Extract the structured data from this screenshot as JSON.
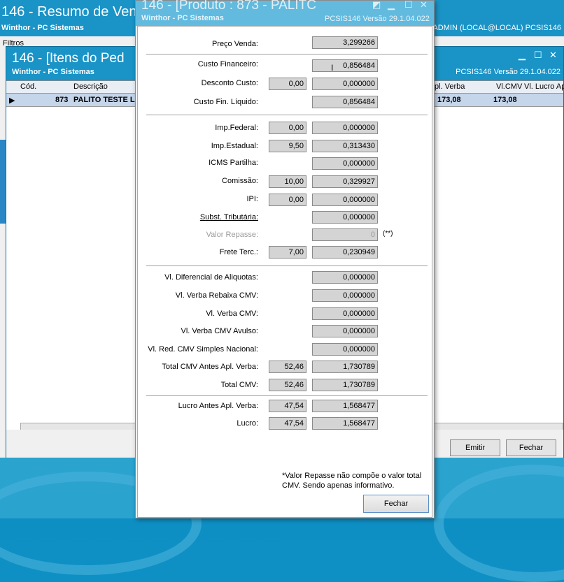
{
  "bg_window1": {
    "title": "146 - Resumo de Ven",
    "subtitle": "Winthor - PC Sistemas",
    "right_info": "ADMIN (LOCAL@LOCAL)   PCSIS146",
    "filtros": "Filtros"
  },
  "bg_window2": {
    "title": "146 - [Itens do Ped",
    "subtitle": "Winthor - PC Sistemas",
    "right_info": "PCSIS146  Versão  29.1.04.022",
    "columns": [
      "Cód.",
      "Descrição",
      "pl. Verba",
      "Vl.CMV",
      "Vl. Lucro Ap"
    ],
    "row": {
      "cod": "873",
      "descricao": "PALITO TESTE LA",
      "apl_verba": "173,08",
      "vl_cmv": "173,08"
    },
    "emitir_label": "Emitir",
    "fechar_label": "Fechar"
  },
  "dialog": {
    "title": "146 - [Produto : 873 - PALITC",
    "subtitle": "Winthor - PC Sistemas",
    "right_info": "PCSIS146  Versão  29.1.04.022",
    "labels": {
      "preco_venda": "Preço Venda:",
      "custo_financeiro": "Custo Financeiro:",
      "desconto_custo": "Desconto Custo:",
      "custo_fin_liquido": "Custo Fin. Líquido:",
      "imp_federal": "Imp.Federal:",
      "imp_estadual": "Imp.Estadual:",
      "icms_partilha": "ICMS Partilha:",
      "comissao": "Comissão:",
      "ipi": "IPI:",
      "subst_tributaria": "Subst. Tributária:",
      "valor_repasse": "Valor Repasse:",
      "frete_terc": "Frete Terc.:",
      "vl_dif_aliquotas": "Vl. Diferencial de Aliquotas:",
      "vl_verba_rebaixa": "Vl. Verba Rebaixa CMV:",
      "vl_verba_cmv": "Vl. Verba CMV:",
      "vl_verba_cmv_avulso": "Vl. Verba CMV Avulso:",
      "vl_red_cmv": "Vl. Red. CMV Simples Nacional:",
      "total_cmv_antes": "Total CMV Antes Apl. Verba:",
      "total_cmv": "Total CMV:",
      "lucro_antes": "Lucro Antes Apl. Verba:",
      "lucro": "Lucro:"
    },
    "values": {
      "preco_venda": "3,299266",
      "custo_financeiro": "0,856484",
      "desconto_custo_pct": "0,00",
      "desconto_custo": "0,000000",
      "custo_fin_liquido": "0,856484",
      "imp_federal_pct": "0,00",
      "imp_federal": "0,000000",
      "imp_estadual_pct": "9,50",
      "imp_estadual": "0,313430",
      "icms_partilha": "0,000000",
      "comissao_pct": "10,00",
      "comissao": "0,329927",
      "ipi_pct": "0,00",
      "ipi": "0,000000",
      "subst_tributaria": "0,000000",
      "valor_repasse": "0",
      "repasse_marker": "(**)",
      "frete_terc_pct": "7,00",
      "frete_terc": "0,230949",
      "vl_dif_aliquotas": "0,000000",
      "vl_verba_rebaixa": "0,000000",
      "vl_verba_cmv": "0,000000",
      "vl_verba_cmv_avulso": "0,000000",
      "vl_red_cmv": "0,000000",
      "total_cmv_antes_pct": "52,46",
      "total_cmv_antes": "1,730789",
      "total_cmv_pct": "52,46",
      "total_cmv": "1,730789",
      "lucro_antes_pct": "47,54",
      "lucro_antes": "1,568477",
      "lucro_pct": "47,54",
      "lucro": "1,568477"
    },
    "note": "*Valor Repasse não compõe o valor total CMV. Sendo apenas informativo.",
    "fechar_label": "Fechar"
  }
}
